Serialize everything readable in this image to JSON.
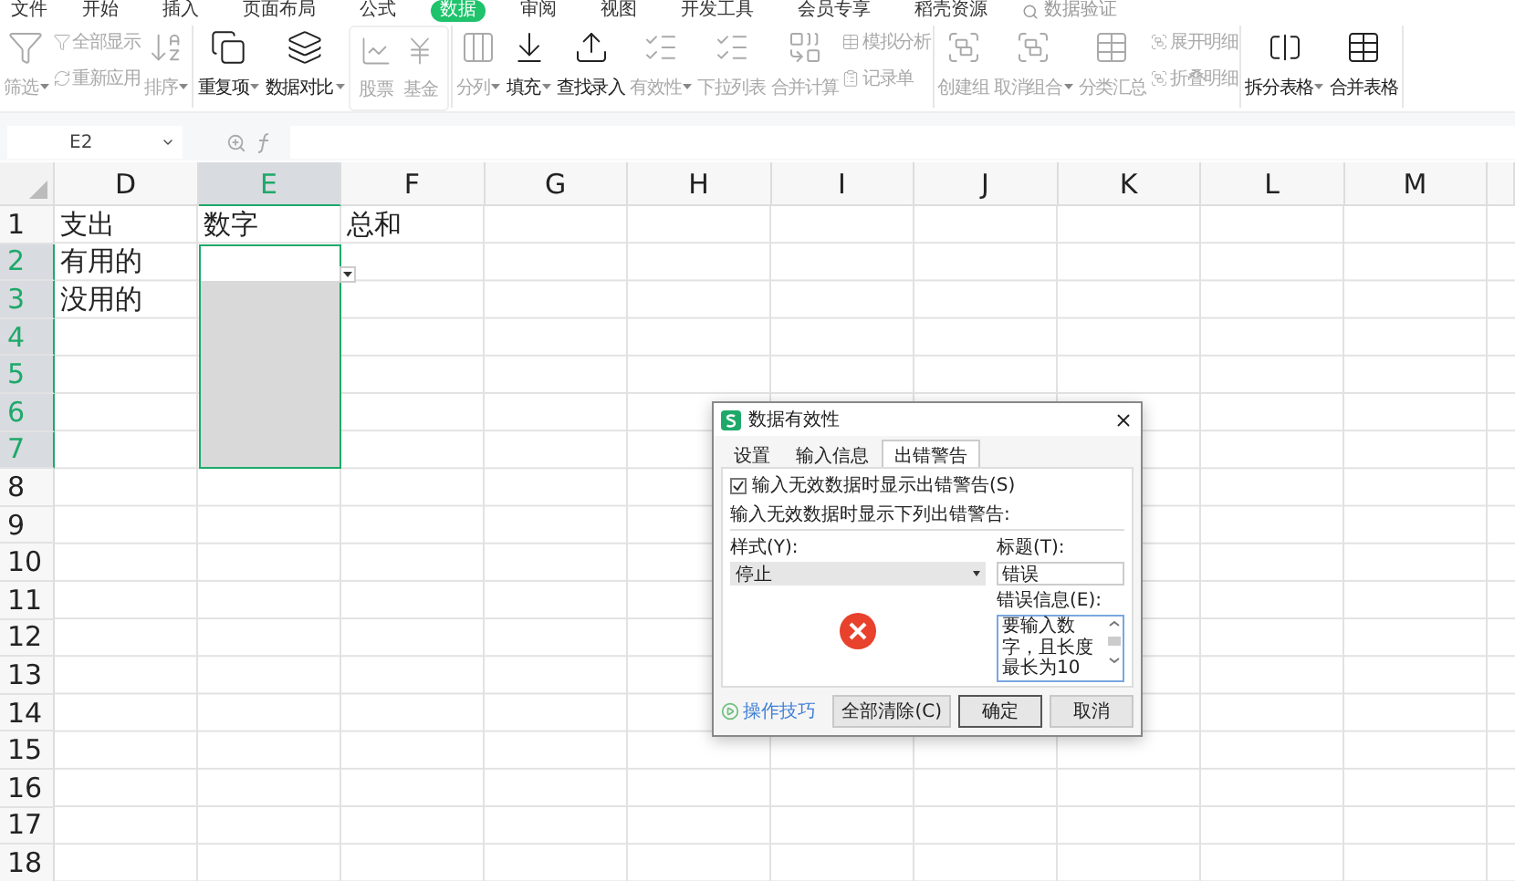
{
  "menu": {
    "file": "文件",
    "tabs": [
      {
        "label": "开始",
        "selected": false
      },
      {
        "label": "插入",
        "selected": false
      },
      {
        "label": "页面布局",
        "selected": false
      },
      {
        "label": "公式",
        "selected": false
      },
      {
        "label": "数据",
        "selected": true
      },
      {
        "label": "审阅",
        "selected": false
      },
      {
        "label": "视图",
        "selected": false
      },
      {
        "label": "开发工具",
        "selected": false
      },
      {
        "label": "会员专享",
        "selected": false
      },
      {
        "label": "稻壳资源",
        "selected": false
      }
    ],
    "search": {
      "placeholder": "数据验证"
    }
  },
  "ribbon": {
    "groups": [
      {
        "items": [
          {
            "kind": "big",
            "label": "筛选",
            "disabled": true,
            "caret": true
          },
          {
            "kind": "stack",
            "items": [
              {
                "label": "全部显示",
                "disabled": true
              },
              {
                "label": "重新应用",
                "disabled": true
              }
            ]
          },
          {
            "kind": "big",
            "label": "排序",
            "disabled": true,
            "caret": true
          }
        ]
      },
      {
        "items": [
          {
            "kind": "big",
            "label": "重复项",
            "disabled": false,
            "caret": true
          },
          {
            "kind": "big",
            "label": "数据对比",
            "disabled": false,
            "caret": true
          },
          {
            "kind": "box",
            "items": [
              {
                "label": "股票",
                "disabled": true
              },
              {
                "label": "基金",
                "disabled": true
              }
            ]
          }
        ]
      },
      {
        "items": [
          {
            "kind": "big",
            "label": "分列",
            "disabled": true,
            "caret": true
          },
          {
            "kind": "big",
            "label": "填充",
            "disabled": false,
            "caret": true
          },
          {
            "kind": "big",
            "label": "查找录入",
            "disabled": false,
            "caret": false
          },
          {
            "kind": "big",
            "label": "有效性",
            "disabled": true,
            "caret": true
          },
          {
            "kind": "big",
            "label": "下拉列表",
            "disabled": true,
            "caret": false
          },
          {
            "kind": "big",
            "label": "合并计算",
            "disabled": true,
            "caret": false
          },
          {
            "kind": "stack",
            "items": [
              {
                "label": "模拟分析",
                "disabled": true
              },
              {
                "label": "记录单",
                "disabled": true
              }
            ]
          }
        ]
      },
      {
        "items": [
          {
            "kind": "big",
            "label": "创建组",
            "disabled": true,
            "caret": false
          },
          {
            "kind": "big",
            "label": "取消组合",
            "disabled": true,
            "caret": true
          },
          {
            "kind": "big",
            "label": "分类汇总",
            "disabled": true,
            "caret": false
          },
          {
            "kind": "stack",
            "items": [
              {
                "label": "展开明细",
                "disabled": true
              },
              {
                "label": "折叠明细",
                "disabled": true
              }
            ]
          }
        ]
      },
      {
        "items": [
          {
            "kind": "big",
            "label": "拆分表格",
            "disabled": false,
            "caret": true
          },
          {
            "kind": "big",
            "label": "合并表格",
            "disabled": false,
            "caret": false
          }
        ]
      }
    ]
  },
  "formula_bar": {
    "name_box": "E2"
  },
  "sheet": {
    "columns": [
      {
        "label": "D",
        "selected": false
      },
      {
        "label": "E",
        "selected": true
      },
      {
        "label": "F",
        "selected": false
      },
      {
        "label": "G",
        "selected": false
      },
      {
        "label": "H",
        "selected": false
      },
      {
        "label": "I",
        "selected": false
      },
      {
        "label": "J",
        "selected": false
      },
      {
        "label": "K",
        "selected": false
      },
      {
        "label": "L",
        "selected": false
      },
      {
        "label": "M",
        "selected": false
      }
    ],
    "rows": [
      {
        "label": "1",
        "selected": false,
        "cells": {
          "D": "支出",
          "E": "数字",
          "F": "总和"
        }
      },
      {
        "label": "2",
        "selected": true,
        "cells": {
          "D": "有用的"
        },
        "dropdown": true
      },
      {
        "label": "3",
        "selected": true,
        "cells": {
          "D": "没用的"
        }
      },
      {
        "label": "4",
        "selected": true
      },
      {
        "label": "5",
        "selected": true
      },
      {
        "label": "6",
        "selected": true
      },
      {
        "label": "7",
        "selected": true
      },
      {
        "label": "8",
        "selected": false
      },
      {
        "label": "9",
        "selected": false
      },
      {
        "label": "10",
        "selected": false
      },
      {
        "label": "11",
        "selected": false
      },
      {
        "label": "12",
        "selected": false
      },
      {
        "label": "13",
        "selected": false
      },
      {
        "label": "14",
        "selected": false
      },
      {
        "label": "15",
        "selected": false
      },
      {
        "label": "16",
        "selected": false
      },
      {
        "label": "17",
        "selected": false
      },
      {
        "label": "18",
        "selected": false
      }
    ]
  },
  "dialog": {
    "title": "数据有效性",
    "tabs": [
      {
        "label": "设置",
        "selected": false
      },
      {
        "label": "输入信息",
        "selected": false
      },
      {
        "label": "出错警告",
        "selected": true
      }
    ],
    "checkbox": {
      "label": "输入无效数据时显示出错警告(S)",
      "checked": true
    },
    "section": "输入无效数据时显示下列出错警告:",
    "style": {
      "label": "样式(Y):",
      "value": "停止"
    },
    "title_field": {
      "label": "标题(T):",
      "value": "错误"
    },
    "message": {
      "label": "错误信息(E):",
      "value": "要输入数字，且长度最长为10"
    },
    "help_link": "操作技巧",
    "buttons": [
      {
        "label": "全部清除(C)",
        "default": false
      },
      {
        "label": "确定",
        "default": true
      },
      {
        "label": "取消",
        "default": false
      }
    ]
  }
}
